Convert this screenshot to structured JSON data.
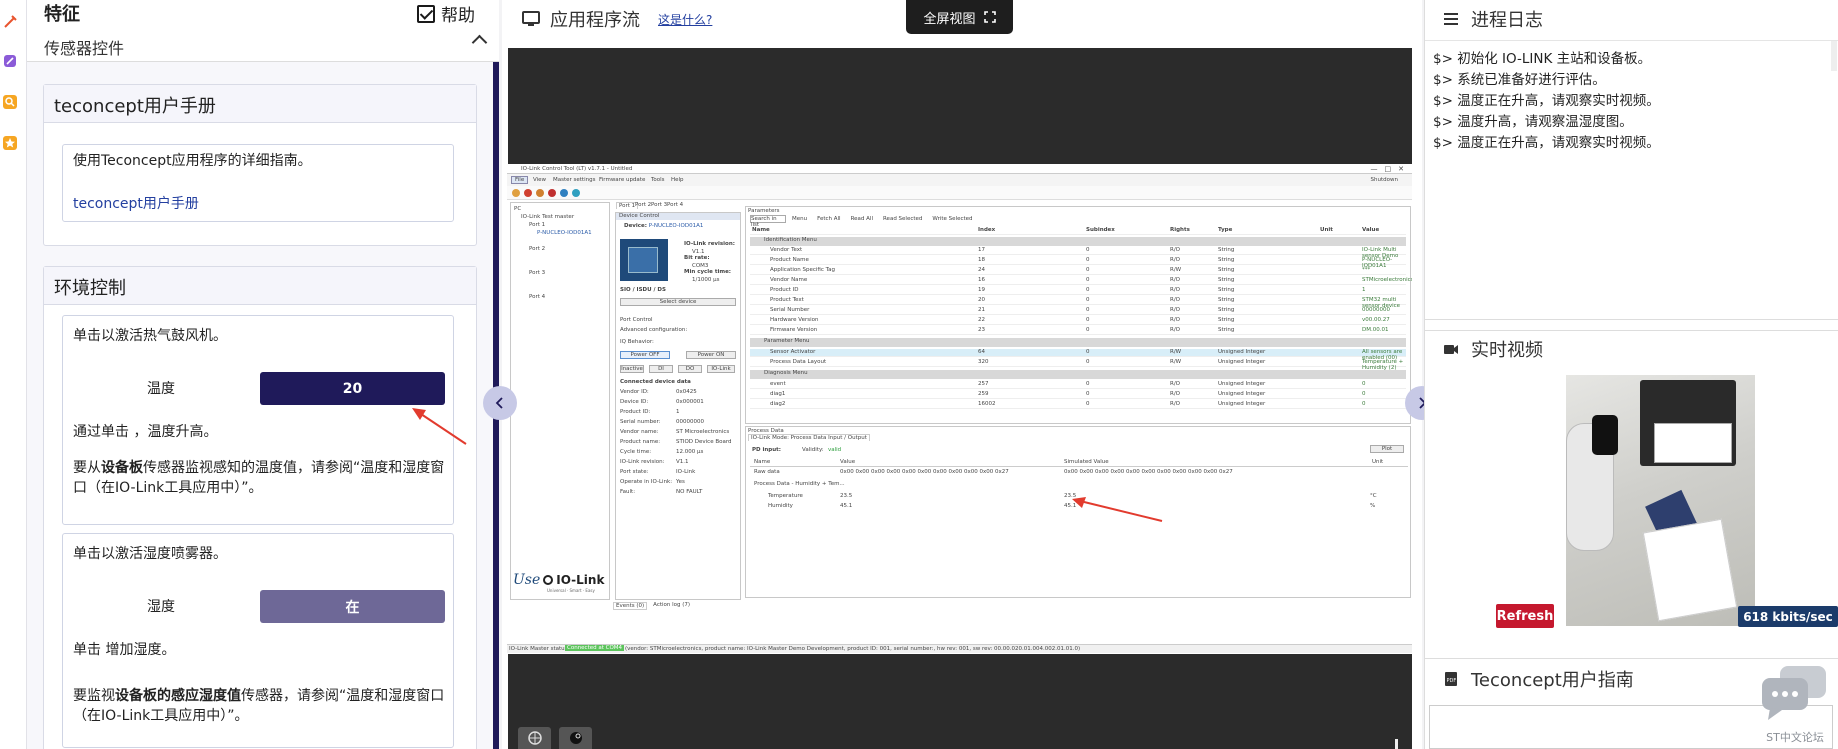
{
  "left": {
    "title": "特征",
    "help_label": "帮助",
    "section_label": "传感器控件",
    "manual_card": {
      "title": "teconcept用户手册",
      "description": "使用Teconcept应用程序的详细指南。",
      "link": "teconcept用户手册"
    },
    "env_card": {
      "title": "环境控制",
      "fan": {
        "instruction": "单击以激活热气鼓风机。",
        "label": "温度",
        "button": "20",
        "note": "通过单击 ，温度升高。",
        "detail_prefix": "要从",
        "detail_bold": "设备板",
        "detail_suffix": "传感器监视感知的温度值，请参阅“温度和湿度窗口（在IO-Link工具应用中）”。"
      },
      "mist": {
        "instruction": "单击以激活湿度喷雾器。",
        "label": "湿度",
        "button": "在",
        "note": "单击 增加湿度。",
        "detail_prefix": "要监视",
        "detail_bold": "设备板的感应湿度值",
        "detail_suffix": "传感器，请参阅“温度和湿度窗口（在IO-Link工具应用中）”。"
      }
    }
  },
  "center": {
    "title": "应用程序流",
    "what_link": "这是什么?",
    "fullscreen": "全屏视图"
  },
  "iolink_app": {
    "window_title": "IO-Link Control Tool (LT) v1.7.1 - Untitled",
    "menu": [
      "File",
      "View",
      "Master settings",
      "Firmware update",
      "Tools",
      "Help"
    ],
    "ports": [
      "Port 1",
      "Port 2",
      "Port 3",
      "Port 4"
    ],
    "params_header": [
      "Name",
      "Index",
      "Subindex",
      "Rights",
      "Type",
      "Unit",
      "Value"
    ],
    "sections": [
      "Identification Menu",
      "Parameter Menu",
      "Diagnosis Menu"
    ],
    "rows": [
      [
        "Vendor Text",
        "17",
        "0",
        "R/O",
        "String",
        "",
        "IO-Link Multi sensor Demo"
      ],
      [
        "Product Name",
        "18",
        "0",
        "R/O",
        "String",
        "",
        "P-NUCLEO-IOD01A1"
      ],
      [
        "Application Specific Tag",
        "24",
        "0",
        "R/W",
        "String",
        "",
        "***"
      ],
      [
        "Vendor Name",
        "16",
        "0",
        "R/O",
        "String",
        "",
        "STMicroelectronics"
      ],
      [
        "Product ID",
        "19",
        "0",
        "R/O",
        "String",
        "",
        "1"
      ],
      [
        "Product Text",
        "20",
        "0",
        "R/O",
        "String",
        "",
        "STM32 multi sensor device"
      ],
      [
        "Serial Number",
        "21",
        "0",
        "R/O",
        "String",
        "",
        "00000000"
      ],
      [
        "Hardware Version",
        "22",
        "0",
        "R/O",
        "String",
        "",
        "v00.00.27"
      ],
      [
        "Firmware Version",
        "23",
        "0",
        "R/O",
        "String",
        "",
        "DM.00.01"
      ]
    ],
    "param_rows": [
      [
        "Sensor Activator",
        "64",
        "0",
        "R/W",
        "Unsigned Integer",
        "",
        "All sensors are enabled (00)"
      ],
      [
        "Process Data Layout",
        "320",
        "0",
        "R/W",
        "Unsigned Integer",
        "",
        "Temperature + Humidity (2)"
      ]
    ],
    "diag_rows": [
      [
        "event",
        "257",
        "0",
        "R/O",
        "Unsigned Integer",
        "",
        "0"
      ],
      [
        "diag1",
        "259",
        "0",
        "R/O",
        "Unsigned Integer",
        "",
        "0"
      ],
      [
        "diag2",
        "16002",
        "0",
        "R/O",
        "Unsigned Integer",
        "",
        "0"
      ]
    ],
    "process_title": "Process Data",
    "process_tab": "IO-Link Mode: Process Data Input / Output",
    "pd_input": "PD input:",
    "validity_label": "Validity:",
    "validity_value": "valid",
    "plot_button": "Plot",
    "pd_header": [
      "Name",
      "Value",
      "Simulated Value",
      "Unit"
    ],
    "raw_label": "Raw data",
    "raw_value": "0x00 0x00 0x00 0x00 0x00 0x00 0x00 0x00 0x00 0x00 0x27",
    "pd_label": "Process Data - Humidity + Tem...",
    "temp_name": "Temperature",
    "temp_val": "23.5",
    "hum_name": "Humidity",
    "hum_val": "45.1",
    "unit_c": "°C",
    "unit_pct": "%",
    "device_control": "Device Control",
    "device_info": {
      "device_label": "Device:",
      "device_value": "P-NUCLEO-IOD01A1",
      "revision": "IO-Link revision:",
      "rev_val": "V1.1",
      "bit_rate": "Bit rate:",
      "bit_val": "COM3",
      "cycle": "Min cycle time:",
      "cycle_val": "1/1000 µs"
    },
    "sio": "SIO / ISDU / DS",
    "select_device": "Select device",
    "port_control": "Port Control",
    "adv_config": "Advanced configuration:",
    "iq_behavior": "IQ Behavior:",
    "power_off": "Power OFF",
    "power_on": "Power ON",
    "inactive": "Inactive",
    "di": "DI",
    "do": "DO",
    "iolink": "IO-Link",
    "conn_title": "Connected device data",
    "conn": [
      [
        "Vendor ID:",
        "0x0425"
      ],
      [
        "Device ID:",
        "0x000001"
      ],
      [
        "Product ID:",
        "1"
      ],
      [
        "Serial number:",
        "00000000"
      ],
      [
        "Vendor name:",
        "ST Microelectronics"
      ],
      [
        "Product name:",
        "STIOD Device Board"
      ],
      [
        "Cycle time:",
        "12.000 µs"
      ],
      [
        "IO-Link revision:",
        "V1.1"
      ],
      [
        "Port state:",
        "IO-Link"
      ],
      [
        "Operate in IO-Link:",
        "Yes"
      ],
      [
        "Fault:",
        "NO FAULT"
      ]
    ],
    "tree": [
      "PC",
      "IO-Link Test master",
      "Port 1",
      "P-NUCLEO-IOD01A1",
      "Port 2",
      "Port 3",
      "Port 4"
    ],
    "logo_use": "Use",
    "logo_main": "IO-Link",
    "logo_sub": "Universal · Smart · Easy",
    "tabs_bottom": [
      "Events (0)",
      "Action log (7)"
    ],
    "status_left": "IO-Link Master status:",
    "status_conn": "Connected at COM4",
    "status_text": "(vendor: STMicroelectronics, product name: IO-Link Master Demo Development, product ID: 001, serial number:, hw rev: 001, sw rev: 00.00.020.01.004.002.01.01.0)",
    "search_placeholder": "Search in list",
    "toolbar": [
      "Menu",
      "Fetch All",
      "Read All",
      "Read Selected",
      "Write Selected"
    ],
    "top_right": "Shutdown"
  },
  "right": {
    "log_title": "进程日志",
    "log_lines": [
      "$> 初始化 IO-LINK 主站和设备板。",
      "$> 系统已准备好进行评估。",
      "$> 温度正在升高，请观察实时视频。",
      "$> 温度升高，请观察温湿度图。",
      "$> 温度正在升高，请观察实时视频。"
    ],
    "video_title": "实时视频",
    "refresh": "Refresh",
    "rate": "618 kbits/sec",
    "guide_title": "Teconcept用户指南",
    "forum": "ST中文论坛"
  },
  "colors": {
    "primary": "#1f1a5a",
    "secondary": "#6e6897",
    "refresh": "#c5182e",
    "rate": "#1b3b6a",
    "arrow": "#e23b2e"
  }
}
